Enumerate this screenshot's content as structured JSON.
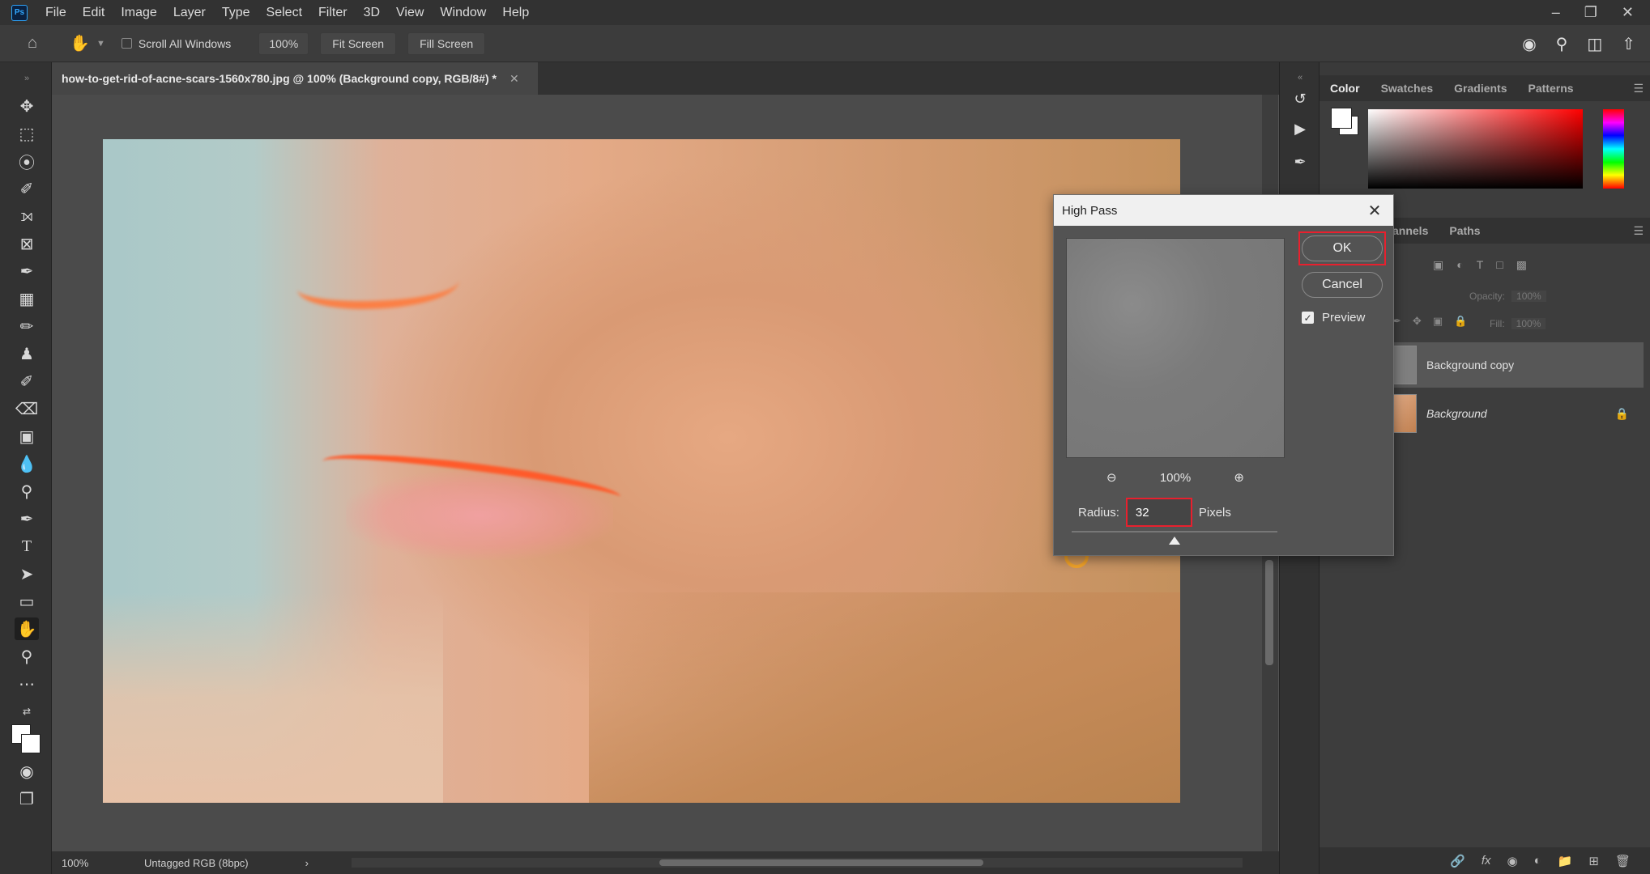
{
  "menubar": {
    "logo": "Ps",
    "items": [
      "File",
      "Edit",
      "Image",
      "Layer",
      "Type",
      "Select",
      "Filter",
      "3D",
      "View",
      "Window",
      "Help"
    ]
  },
  "options": {
    "scroll_all_windows": "Scroll All Windows",
    "zoom": "100%",
    "fit_screen": "Fit Screen",
    "fill_screen": "Fill Screen"
  },
  "document": {
    "tab_title": "how-to-get-rid-of-acne-scars-1560x780.jpg @ 100% (Background copy, RGB/8#) *"
  },
  "status": {
    "zoom": "100%",
    "profile": "Untagged RGB (8bpc)"
  },
  "color_panel": {
    "tabs": [
      "Color",
      "Swatches",
      "Gradients",
      "Patterns"
    ]
  },
  "layers_panel": {
    "tabs": [
      "annels",
      "Paths"
    ],
    "opacity_label": "Opacity:",
    "opacity_value": "100%",
    "fill_label": "Fill:",
    "fill_value": "100%",
    "layers": [
      {
        "name": "Background copy",
        "selected": true
      },
      {
        "name": "Background",
        "selected": false,
        "locked": true
      }
    ]
  },
  "dialog": {
    "title": "High Pass",
    "ok_label": "OK",
    "cancel_label": "Cancel",
    "preview_label": "Preview",
    "preview_checked": true,
    "zoom": "100%",
    "radius_label": "Radius:",
    "radius_value": "32",
    "radius_unit": "Pixels"
  },
  "colors": {
    "highlight": "#e8202e",
    "accent_blue": "#31a8ff"
  }
}
